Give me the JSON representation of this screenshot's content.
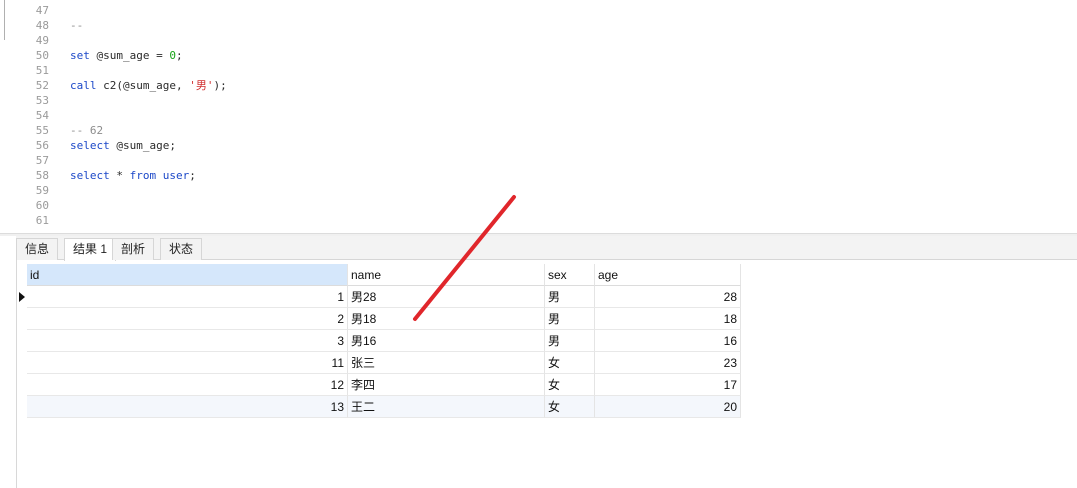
{
  "editor": {
    "lines": [
      {
        "no": "47",
        "tokens": []
      },
      {
        "no": "48",
        "tokens": [
          {
            "t": "--",
            "c": "cmt"
          }
        ]
      },
      {
        "no": "49",
        "tokens": []
      },
      {
        "no": "50",
        "tokens": [
          {
            "t": "set",
            "c": "kw"
          },
          {
            "t": " @sum_age = ",
            "c": ""
          },
          {
            "t": "0",
            "c": "num"
          },
          {
            "t": ";",
            "c": ""
          }
        ]
      },
      {
        "no": "51",
        "tokens": []
      },
      {
        "no": "52",
        "tokens": [
          {
            "t": "call",
            "c": "kw"
          },
          {
            "t": " c2(@sum_age, ",
            "c": ""
          },
          {
            "t": "'男'",
            "c": "str"
          },
          {
            "t": ");",
            "c": ""
          }
        ]
      },
      {
        "no": "53",
        "tokens": []
      },
      {
        "no": "54",
        "tokens": []
      },
      {
        "no": "55",
        "tokens": [
          {
            "t": "-- 62",
            "c": "cmt"
          }
        ]
      },
      {
        "no": "56",
        "tokens": [
          {
            "t": "select",
            "c": "kw"
          },
          {
            "t": " @sum_age;",
            "c": ""
          }
        ]
      },
      {
        "no": "57",
        "tokens": []
      },
      {
        "no": "58",
        "tokens": [
          {
            "t": "select",
            "c": "kw"
          },
          {
            "t": " * ",
            "c": ""
          },
          {
            "t": "from",
            "c": "kw"
          },
          {
            "t": " ",
            "c": ""
          },
          {
            "t": "user",
            "c": "kw"
          },
          {
            "t": ";",
            "c": ""
          }
        ]
      },
      {
        "no": "59",
        "tokens": []
      },
      {
        "no": "60",
        "tokens": []
      },
      {
        "no": "61",
        "tokens": []
      }
    ]
  },
  "tabs": [
    {
      "label": "信息",
      "active": false
    },
    {
      "label": "结果 1",
      "active": true
    },
    {
      "label": "剖析",
      "active": false
    },
    {
      "label": "状态",
      "active": false
    }
  ],
  "result": {
    "columns": [
      "id",
      "name",
      "sex",
      "age"
    ],
    "rows": [
      {
        "id": "1",
        "name": "男28",
        "sex": "男",
        "age": "28"
      },
      {
        "id": "2",
        "name": "男18",
        "sex": "男",
        "age": "18"
      },
      {
        "id": "3",
        "name": "男16",
        "sex": "男",
        "age": "16"
      },
      {
        "id": "11",
        "name": "张三",
        "sex": "女",
        "age": "23"
      },
      {
        "id": "12",
        "name": "李四",
        "sex": "女",
        "age": "17"
      },
      {
        "id": "13",
        "name": "王二",
        "sex": "女",
        "age": "20"
      }
    ],
    "current_row": 0
  },
  "colors": {
    "keyword": "#1c48c8",
    "number": "#17a317",
    "string": "#d03030",
    "comment": "#8c8c8c",
    "header_selected": "#d5e7fb",
    "annotation_stroke": "#e0262b"
  }
}
